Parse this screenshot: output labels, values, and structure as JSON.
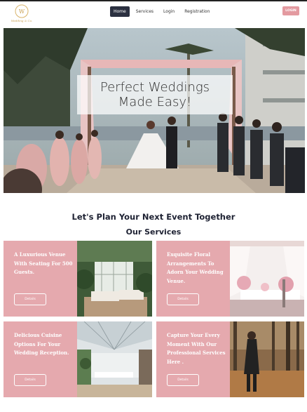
{
  "nav": {
    "logo_text": "Wedding & Co.",
    "links": [
      "Home",
      "Services",
      "Login",
      "Registration"
    ],
    "login_button": "LOGIN"
  },
  "hero": {
    "title_line1": "Perfect Weddings",
    "title_line2": "Made Easy!"
  },
  "event_heading": "Let's Plan Your Next Event Together",
  "services_heading": "Our Services",
  "cards": [
    {
      "description": "A Luxurious Venue With Seating For 500 Guests.",
      "button": "Details",
      "image_icon": "greenhouse-venue"
    },
    {
      "description": "Exquisite Floral Arrangements To Adorn Your Wedding Venue.",
      "button": "Details",
      "image_icon": "floral-table"
    },
    {
      "description": "Delicious Cuisine Options For Your Wedding Reception.",
      "button": "Details",
      "image_icon": "glass-hall"
    },
    {
      "description": "Capture Your Every Moment With Our Professional Services Here .",
      "button": "Details",
      "image_icon": "photographer-forest"
    }
  ],
  "colors": {
    "accent_pink": "#e5a9ae",
    "nav_active": "#2b3040",
    "heading": "#1e2233"
  }
}
